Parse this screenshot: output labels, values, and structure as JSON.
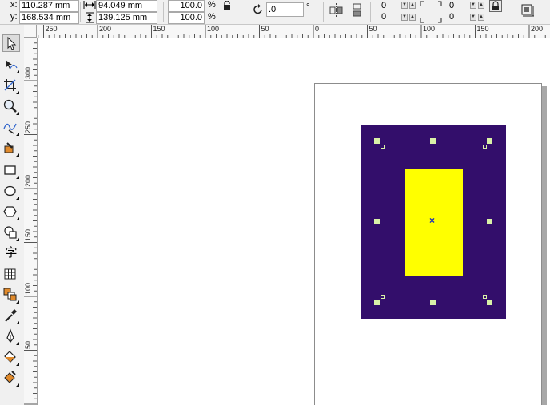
{
  "property_bar": {
    "x_label": "x:",
    "x_value": "110.287 mm",
    "y_label": "y:",
    "y_value": "168.534 mm",
    "width_value": "94.049 mm",
    "height_value": "139.125 mm",
    "scale_x": "100.0",
    "scale_y": "100.0",
    "percent_symbol": "%",
    "rotation_value": ".0",
    "degree_symbol": "°",
    "corner_top_left": "0",
    "corner_bottom_left": "0",
    "corner_top_right": "0",
    "corner_bottom_right": "0",
    "spin_up": "▲",
    "spin_down": "▼"
  },
  "ruler": {
    "top_labels": [
      "250",
      "200",
      "150",
      "100",
      "50",
      "0",
      "50",
      "100",
      "150",
      "200"
    ],
    "left_labels": [
      "300",
      "250",
      "200",
      "150",
      "100",
      "50"
    ]
  },
  "toolbox": {
    "tools": [
      "pick-tool-icon",
      "shape-tool-icon",
      "crop-tool-icon",
      "zoom-tool-icon",
      "freehand-tool-icon",
      "smart-fill-tool-icon",
      "rectangle-tool-icon",
      "ellipse-tool-icon",
      "polygon-tool-icon",
      "basic-shapes-tool-icon",
      "text-tool-icon",
      "table-tool-icon",
      "interactive-tool-icon",
      "eyedropper-tool-icon",
      "outline-tool-icon",
      "fill-tool-icon",
      "interactive-fill-tool-icon"
    ],
    "text_tool_glyph": "字",
    "active_tool": "pick-tool-icon"
  },
  "document": {
    "outer_rect_color": "#330e6b",
    "inner_rect_color": "#ffff00",
    "selection_handle_color": "#d9f1a8",
    "center_marker": "×"
  }
}
